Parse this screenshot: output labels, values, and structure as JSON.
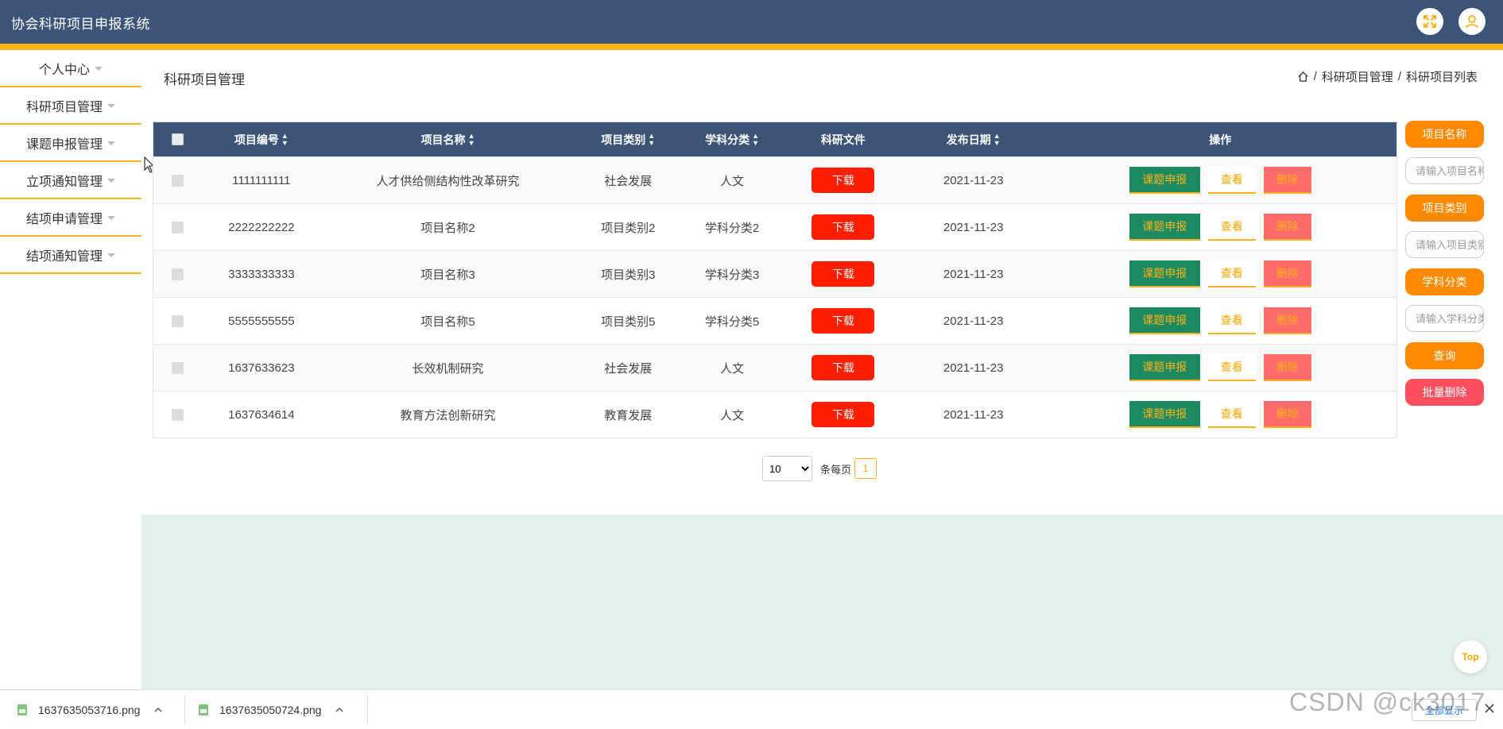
{
  "app": {
    "title": "协会科研项目申报系统"
  },
  "header_icons": [
    "fullscreen-icon",
    "user-icon"
  ],
  "sidebar": {
    "items": [
      {
        "label": "个人中心"
      },
      {
        "label": "科研项目管理"
      },
      {
        "label": "课题申报管理"
      },
      {
        "label": "立项通知管理"
      },
      {
        "label": "结项申请管理"
      },
      {
        "label": "结项通知管理"
      }
    ]
  },
  "main": {
    "title": "科研项目管理",
    "breadcrumb": [
      "科研项目管理",
      "科研项目列表"
    ],
    "breadcrumb_sep": "/"
  },
  "table": {
    "columns": [
      "项目编号",
      "项目名称",
      "项目类别",
      "学科分类",
      "科研文件",
      "发布日期",
      "操作"
    ],
    "rows": [
      {
        "code": "1111111111",
        "name": "人才供给侧结构性改革研究",
        "category": "社会发展",
        "subject": "人文",
        "date": "2021-11-23"
      },
      {
        "code": "2222222222",
        "name": "项目名称2",
        "category": "项目类别2",
        "subject": "学科分类2",
        "date": "2021-11-23"
      },
      {
        "code": "3333333333",
        "name": "项目名称3",
        "category": "项目类别3",
        "subject": "学科分类3",
        "date": "2021-11-23"
      },
      {
        "code": "5555555555",
        "name": "项目名称5",
        "category": "项目类别5",
        "subject": "学科分类5",
        "date": "2021-11-23"
      },
      {
        "code": "1637633623",
        "name": "长效机制研究",
        "category": "社会发展",
        "subject": "人文",
        "date": "2021-11-23"
      },
      {
        "code": "1637634614",
        "name": "教育方法创新研究",
        "category": "教育发展",
        "subject": "人文",
        "date": "2021-11-23"
      }
    ],
    "actions": {
      "download": "下载",
      "apply": "课题申报",
      "view": "查看",
      "delete": "删除"
    }
  },
  "pagination": {
    "page_size": "10",
    "per_page_label": "条每页",
    "current_page": "1"
  },
  "search": {
    "name_label": "项目名称",
    "name_placeholder": "请输入项目名称",
    "category_label": "项目类别",
    "category_placeholder": "请输入项目类别",
    "subject_label": "学科分类",
    "subject_placeholder": "请输入学科分类",
    "query_label": "查询",
    "batch_delete_label": "批量删除"
  },
  "top_button": "Top",
  "downloads": {
    "files": [
      "1637635053716.png",
      "1637635050724.png"
    ],
    "show_all": "全部显示"
  },
  "watermark": "CSDN @ck3017",
  "colors": {
    "header": "#3c5478",
    "accent": "#ffb21a",
    "orange": "#ff8a00",
    "download_red": "#ff1e00",
    "apply_green": "#1b8a60",
    "delete_pink": "#ff6a6a",
    "lower_area": "#e4f0ec"
  }
}
